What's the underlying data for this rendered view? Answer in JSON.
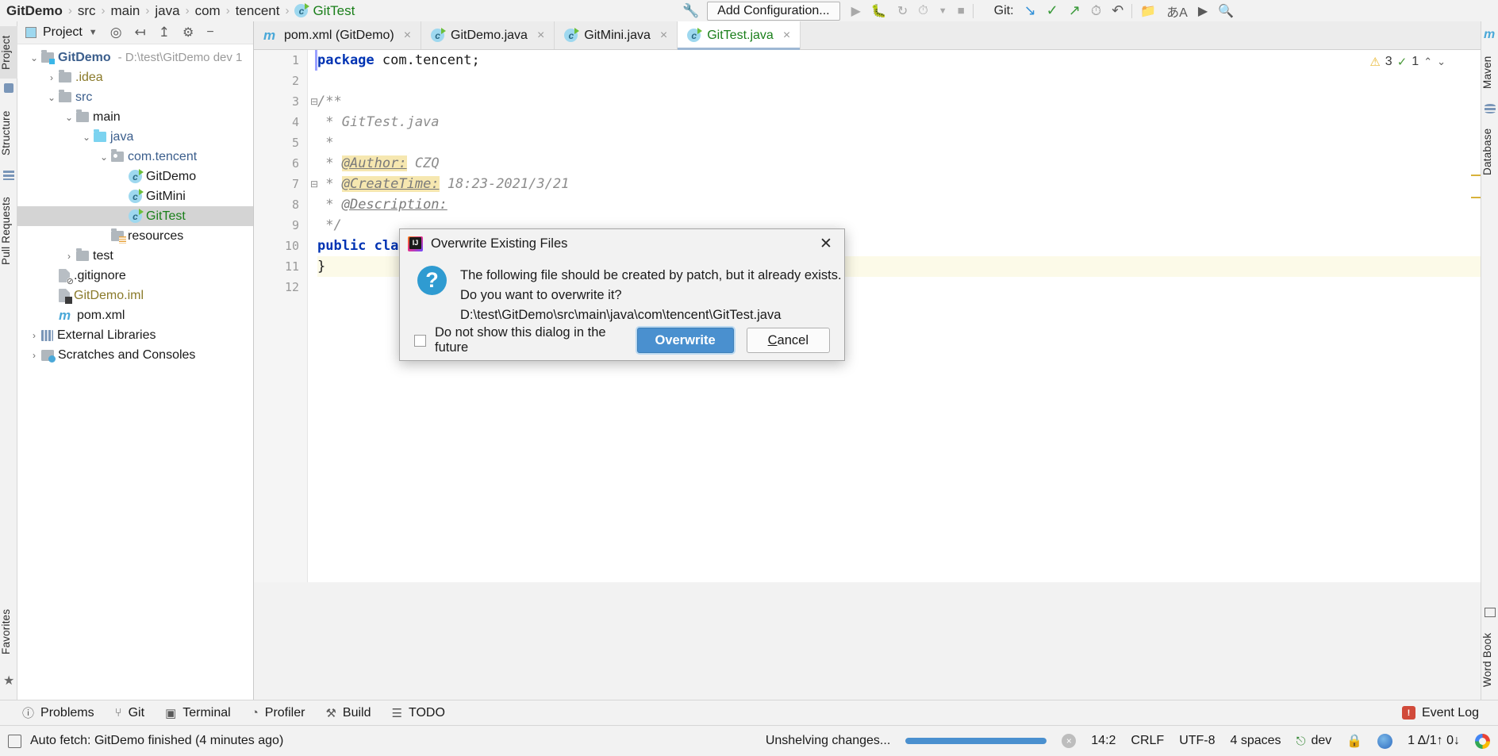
{
  "breadcrumb": {
    "items": [
      "GitDemo",
      "src",
      "main",
      "java",
      "com",
      "tencent",
      "GitTest"
    ],
    "separator": "›"
  },
  "toolbar": {
    "wrench_icon": "wrench-icon",
    "add_configuration": "Add Configuration...",
    "git_label": "Git:",
    "run_icons": [
      "run-icon",
      "debug-icon",
      "run-with-coverage-icon",
      "profile-icon",
      "dropdown-icon",
      "stop-icon"
    ],
    "git_icons": [
      "update-project-icon",
      "commit-icon",
      "push-icon",
      "history-icon",
      "rollback-icon"
    ],
    "right_icons": [
      "project-structure-icon",
      "translate-icon",
      "present-icon",
      "search-icon"
    ]
  },
  "left_tool_strip": {
    "items": [
      "Project",
      "Structure",
      "Pull Requests"
    ],
    "bottom_items": [
      "Favorites"
    ],
    "selected": "Project"
  },
  "right_tool_strip": {
    "items": [
      "m",
      "Maven",
      "Database"
    ],
    "bottom_items": [
      "Word Book"
    ]
  },
  "project_panel": {
    "title": "Project",
    "dropdown_icon": "chevron-down-icon",
    "tool_icons": [
      "locate-icon",
      "expand-all-icon",
      "collapse-all-icon",
      "settings-gear-icon",
      "hide-icon"
    ],
    "tree": [
      {
        "label": "GitDemo",
        "sub": "- D:\\test\\GitDemo dev 1",
        "indent": 0,
        "chev": "⌄",
        "icon": "module-folder",
        "color": "c-blue",
        "bold": true,
        "selected": false
      },
      {
        "label": ".idea",
        "sub": "",
        "indent": 1,
        "chev": "›",
        "icon": "folder",
        "color": "c-amber",
        "bold": false,
        "selected": false
      },
      {
        "label": "src",
        "sub": "",
        "indent": 1,
        "chev": "⌄",
        "icon": "folder",
        "color": "c-blue",
        "bold": false,
        "selected": false
      },
      {
        "label": "main",
        "sub": "",
        "indent": 2,
        "chev": "⌄",
        "icon": "folder",
        "color": "c-dark",
        "bold": false,
        "selected": false
      },
      {
        "label": "java",
        "sub": "",
        "indent": 3,
        "chev": "⌄",
        "icon": "source-folder",
        "color": "c-blue",
        "bold": false,
        "selected": false
      },
      {
        "label": "com.tencent",
        "sub": "",
        "indent": 4,
        "chev": "⌄",
        "icon": "package",
        "color": "c-blue",
        "bold": false,
        "selected": false
      },
      {
        "label": "GitDemo",
        "sub": "",
        "indent": 5,
        "chev": "",
        "icon": "java-class",
        "color": "c-dark",
        "bold": false,
        "selected": false
      },
      {
        "label": "GitMini",
        "sub": "",
        "indent": 5,
        "chev": "",
        "icon": "java-class",
        "color": "c-dark",
        "bold": false,
        "selected": false
      },
      {
        "label": "GitTest",
        "sub": "",
        "indent": 5,
        "chev": "",
        "icon": "java-class",
        "color": "c-green",
        "bold": false,
        "selected": true
      },
      {
        "label": "resources",
        "sub": "",
        "indent": 4,
        "chev": "",
        "icon": "resources-folder",
        "color": "c-dark",
        "bold": false,
        "selected": false
      },
      {
        "label": "test",
        "sub": "",
        "indent": 2,
        "chev": "›",
        "icon": "folder",
        "color": "c-dark",
        "bold": false,
        "selected": false
      },
      {
        "label": ".gitignore",
        "sub": "",
        "indent": 1,
        "chev": "",
        "icon": "gitignore-file",
        "color": "c-dark",
        "bold": false,
        "selected": false
      },
      {
        "label": "GitDemo.iml",
        "sub": "",
        "indent": 1,
        "chev": "",
        "icon": "iml-file",
        "color": "c-amber",
        "bold": false,
        "selected": false
      },
      {
        "label": "pom.xml",
        "sub": "",
        "indent": 1,
        "chev": "",
        "icon": "maven-file",
        "color": "c-dark",
        "bold": false,
        "selected": false
      },
      {
        "label": "External Libraries",
        "sub": "",
        "indent": 0,
        "chev": "›",
        "icon": "library",
        "color": "c-dark",
        "bold": false,
        "selected": false
      },
      {
        "label": "Scratches and Consoles",
        "sub": "",
        "indent": 0,
        "chev": "›",
        "icon": "scratches",
        "color": "c-dark",
        "bold": false,
        "selected": false
      }
    ]
  },
  "editor": {
    "tabs": [
      {
        "label": "pom.xml (GitDemo)",
        "icon": "maven-file-icon",
        "active": false,
        "close": "×"
      },
      {
        "label": "GitDemo.java",
        "icon": "java-class-icon",
        "active": false,
        "close": "×"
      },
      {
        "label": "GitMini.java",
        "icon": "java-class-icon",
        "active": false,
        "close": "×"
      },
      {
        "label": "GitTest.java",
        "icon": "java-class-icon",
        "active": true,
        "close": "×"
      }
    ],
    "line_numbers": [
      "1",
      "2",
      "3",
      "4",
      "5",
      "6",
      "7",
      "8",
      "9",
      "10",
      "11",
      "12"
    ],
    "code_lines": [
      {
        "n": 1,
        "segments": [
          {
            "t": "package ",
            "c": "kw"
          },
          {
            "t": "com.tencent;",
            "c": ""
          }
        ],
        "highlight": false
      },
      {
        "n": 2,
        "segments": [],
        "highlight": false
      },
      {
        "n": 3,
        "segments": [
          {
            "t": "/**",
            "c": "cm"
          }
        ],
        "highlight": false
      },
      {
        "n": 4,
        "segments": [
          {
            "t": " * GitTest.java",
            "c": "cm"
          }
        ],
        "highlight": false
      },
      {
        "n": 5,
        "segments": [
          {
            "t": " *",
            "c": "cm"
          }
        ],
        "highlight": false
      },
      {
        "n": 6,
        "segments": [
          {
            "t": " * ",
            "c": "cm"
          },
          {
            "t": "@Author:",
            "c": "cm-tag"
          },
          {
            "t": " CZQ",
            "c": "cm"
          }
        ],
        "highlight": false
      },
      {
        "n": 7,
        "segments": [
          {
            "t": " * ",
            "c": "cm"
          },
          {
            "t": "@CreateTime:",
            "c": "cm-tag"
          },
          {
            "t": " 18:23-2021/3/21",
            "c": "cm"
          }
        ],
        "highlight": false
      },
      {
        "n": 8,
        "segments": [
          {
            "t": " * ",
            "c": "cm"
          },
          {
            "t": "@Description:",
            "c": "cm-tag2"
          }
        ],
        "highlight": false
      },
      {
        "n": 9,
        "segments": [
          {
            "t": " */",
            "c": "cm"
          }
        ],
        "highlight": false
      },
      {
        "n": 10,
        "segments": [
          {
            "t": "public ",
            "c": "kw"
          },
          {
            "t": "clas",
            "c": "kw"
          }
        ],
        "highlight": false
      },
      {
        "n": 11,
        "segments": [
          {
            "t": "}",
            "c": ""
          }
        ],
        "highlight": true
      },
      {
        "n": 12,
        "segments": [],
        "highlight": false
      }
    ],
    "inspection": {
      "warning_count": "3",
      "checked_count": "1",
      "warning_icon": "warning-triangle-icon",
      "ok_icon": "inspection-check-icon",
      "up_icon": "⌃",
      "down_icon": "⌄"
    }
  },
  "dialog": {
    "title": "Overwrite Existing Files",
    "icon": "intellij-idea-logo",
    "close_icon": "✕",
    "question_icon": "question-mark-icon",
    "message_line1": "The following file should be created by patch, but it already exists.",
    "message_line2": "Do you want to overwrite it?",
    "message_line3": "D:\\test\\GitDemo\\src\\main\\java\\com\\tencent\\GitTest.java",
    "checkbox_label": "Do not show this dialog in the future",
    "checkbox_checked": false,
    "overwrite_button": "Overwrite",
    "cancel_button_prefix": "C",
    "cancel_button_rest": "ancel",
    "accent_color": "#4a90cf"
  },
  "bottom_toolwindows": {
    "items": [
      {
        "label": "Problems",
        "icon": "problems-icon"
      },
      {
        "label": "Git",
        "icon": "git-branch-icon"
      },
      {
        "label": "Terminal",
        "icon": "terminal-icon"
      },
      {
        "label": "Profiler",
        "icon": "profiler-icon"
      },
      {
        "label": "Build",
        "icon": "build-hammer-icon"
      },
      {
        "label": "TODO",
        "icon": "todo-list-icon"
      }
    ],
    "event_log": "Event Log",
    "event_log_icon": "event-log-icon"
  },
  "status_bar": {
    "message": "Auto fetch: GitDemo finished (4 minutes ago)",
    "message_icon": "status-message-icon",
    "progress_text": "Unshelving changes...",
    "progress_percent": 100,
    "progress_cancel": "×",
    "caret_position": "14:2",
    "line_separator": "CRLF",
    "encoding": "UTF-8",
    "indent": "4 spaces",
    "branch": "dev",
    "branch_icon": "git-branch-icon",
    "lock_icon": "lock-icon",
    "ide_blob_icon": "ide-indicator-icon",
    "notify_text": "1 Δ/1↑ 0↓",
    "google_icon": "google-icon"
  }
}
